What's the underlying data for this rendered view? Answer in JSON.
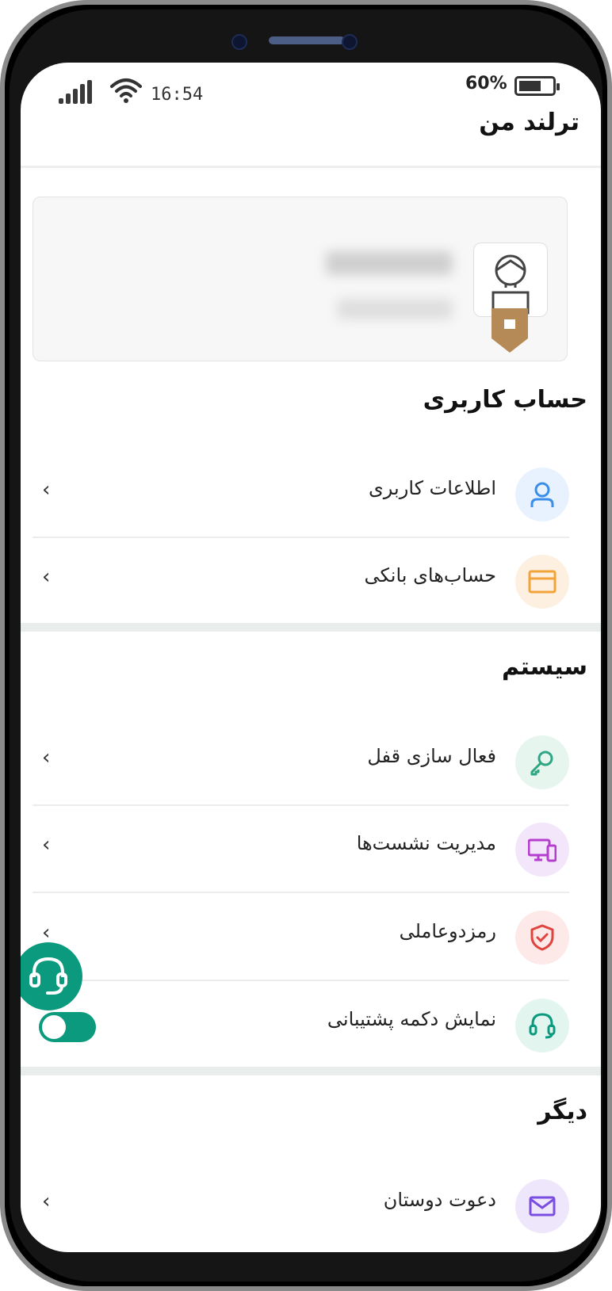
{
  "status_bar": {
    "time": "16:54",
    "battery_percent": "60%"
  },
  "header": {
    "title": "ترلند من"
  },
  "sections": {
    "account": {
      "title": "حساب کاربری",
      "items": [
        {
          "label": "اطلاعات کاربری",
          "icon": "user-icon",
          "color": "#3b8ee8",
          "bg": "#e8f2fe"
        },
        {
          "label": "حساب‌های بانکی",
          "icon": "card-icon",
          "color": "#f2a33a",
          "bg": "#fdf0e0"
        }
      ]
    },
    "system": {
      "title": "سیستم",
      "items": [
        {
          "label": "فعال سازی قفل",
          "icon": "key-icon",
          "color": "#2fa683",
          "bg": "#e6f6ef"
        },
        {
          "label": "مدیریت نشست‌ها",
          "icon": "devices-icon",
          "color": "#b53ecf",
          "bg": "#f4e6fa"
        },
        {
          "label": "رمزدوعاملی",
          "icon": "shield-icon",
          "color": "#e0443e",
          "bg": "#fde9e8"
        },
        {
          "label": "نمایش دکمه پشتیبانی",
          "icon": "headset-icon",
          "color": "#0b9a7d",
          "bg": "#e3f5ef",
          "toggle_on": true
        }
      ]
    },
    "other": {
      "title": "دیگر",
      "items": [
        {
          "label": "دعوت دوستان",
          "icon": "invite-icon",
          "color": "#7a4ee0",
          "bg": "#eee7fc"
        }
      ]
    }
  },
  "accent": "#0b9a7d"
}
